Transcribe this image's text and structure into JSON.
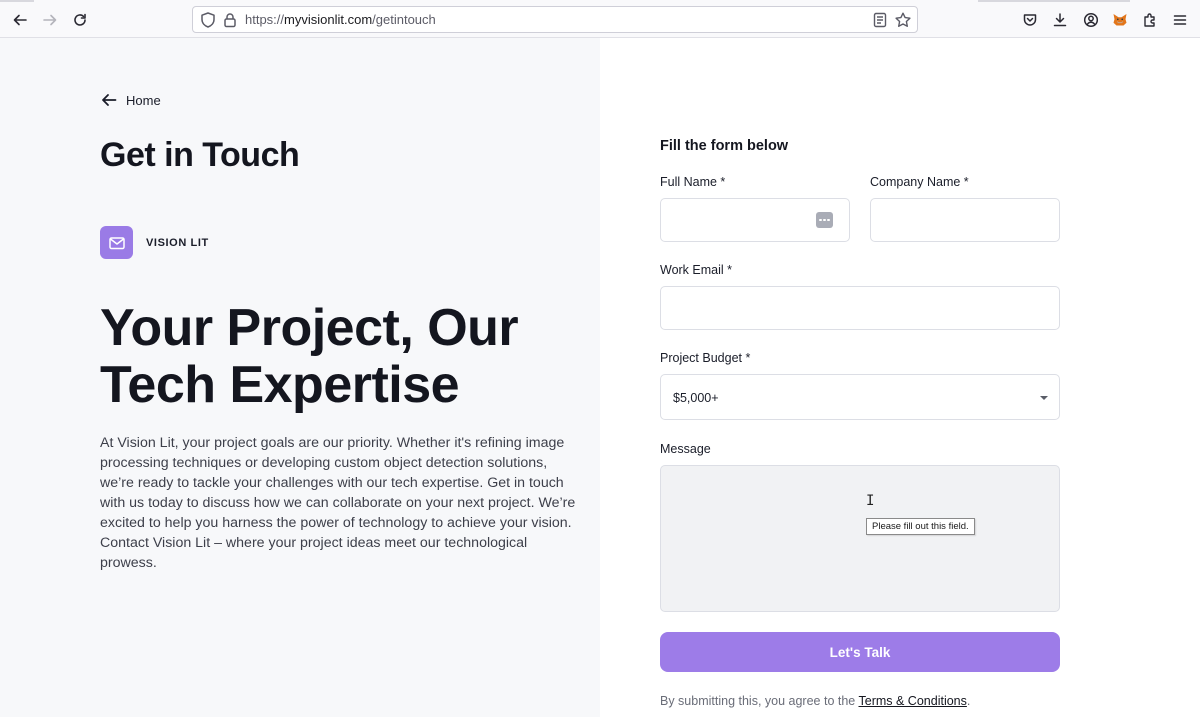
{
  "browser": {
    "url_prefix": "https://",
    "url_host": "myvisionlit.com",
    "url_path": "/getintouch",
    "icons": [
      "back-icon",
      "forward-icon",
      "reload-icon",
      "shield-icon",
      "lock-icon",
      "reader-view-icon",
      "bookmark-star-icon",
      "pocket-icon",
      "downloads-icon",
      "account-icon",
      "metamask-fox-icon",
      "extensions-icon",
      "menu-icon"
    ]
  },
  "left": {
    "home_label": "Home",
    "page_title": "Get in Touch",
    "brand_name": "VISION LIT",
    "hero_line1": "Your Project, Our",
    "hero_line2": "Tech Expertise",
    "body_text": "At Vision Lit, your project goals are our priority. Whether it's refining image processing techniques or developing custom object detection solutions, we’re ready to tackle your challenges with our tech expertise. Get in touch with us today to discuss how we can collaborate on your next project. We’re excited to help you harness the power of technology to achieve your vision. Contact Vision Lit – where your project ideas meet our technological prowess."
  },
  "form": {
    "heading": "Fill the form below",
    "full_name_label": "Full Name *",
    "full_name_value": "",
    "company_label": "Company Name *",
    "company_value": "",
    "email_label": "Work Email *",
    "email_value": "",
    "budget_label": "Project Budget *",
    "budget_value": "$5,000+",
    "message_label": "Message",
    "message_value": "",
    "validation_tooltip": "Please fill out this field.",
    "submit_label": "Let's Talk",
    "terms_prefix": "By submitting this, you agree to the ",
    "terms_link": "Terms & Conditions",
    "terms_suffix": "."
  },
  "colors": {
    "accent": "#9d7ce8",
    "left_bg": "#f7f8fa",
    "heading": "#14161f"
  }
}
